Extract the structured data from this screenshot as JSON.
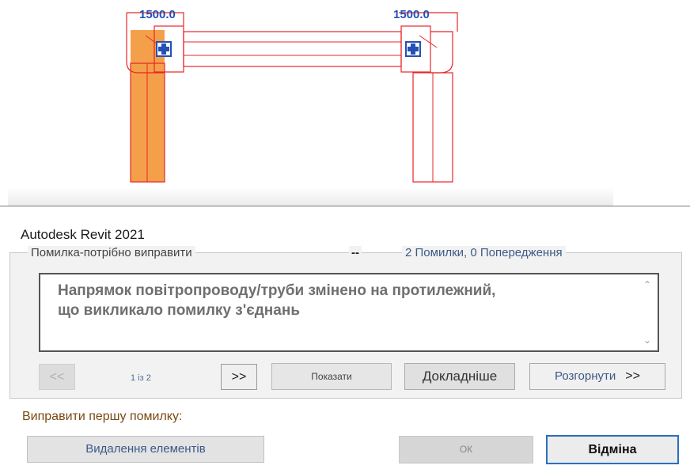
{
  "canvas": {
    "dimension_left": "1500.0",
    "dimension_right": "1500.0"
  },
  "dialog": {
    "title": "Autodesk Revit 2021",
    "group_label": "Помилка-потрібно виправити",
    "separator": "--",
    "error_count": "2 Помилки, 0 Попередження",
    "message_line1": "Напрямок повітропроводу/труби змінено на протилежний,",
    "message_line2": "що викликало помилку з'єднань",
    "nav": {
      "prev_label": "<<",
      "counter": "1 із 2",
      "next_label": ">>"
    },
    "show_label": "Показати",
    "details_label": "Докладніше",
    "expand_label": "Розгорнути",
    "expand_chevron": ">>",
    "fix_label": "Виправити першу помилку:",
    "delete_label": "Видалення елементів",
    "ok_label": "ОК",
    "cancel_label": "Відміна"
  },
  "colors": {
    "model_red": "#e8252a",
    "highlight_orange": "#f4a04a",
    "dimension_blue": "#2450b8",
    "focus_blue": "#2b6fbf"
  },
  "icons": [
    "connector-icon",
    "chevron-up-icon",
    "chevron-down-icon"
  ]
}
